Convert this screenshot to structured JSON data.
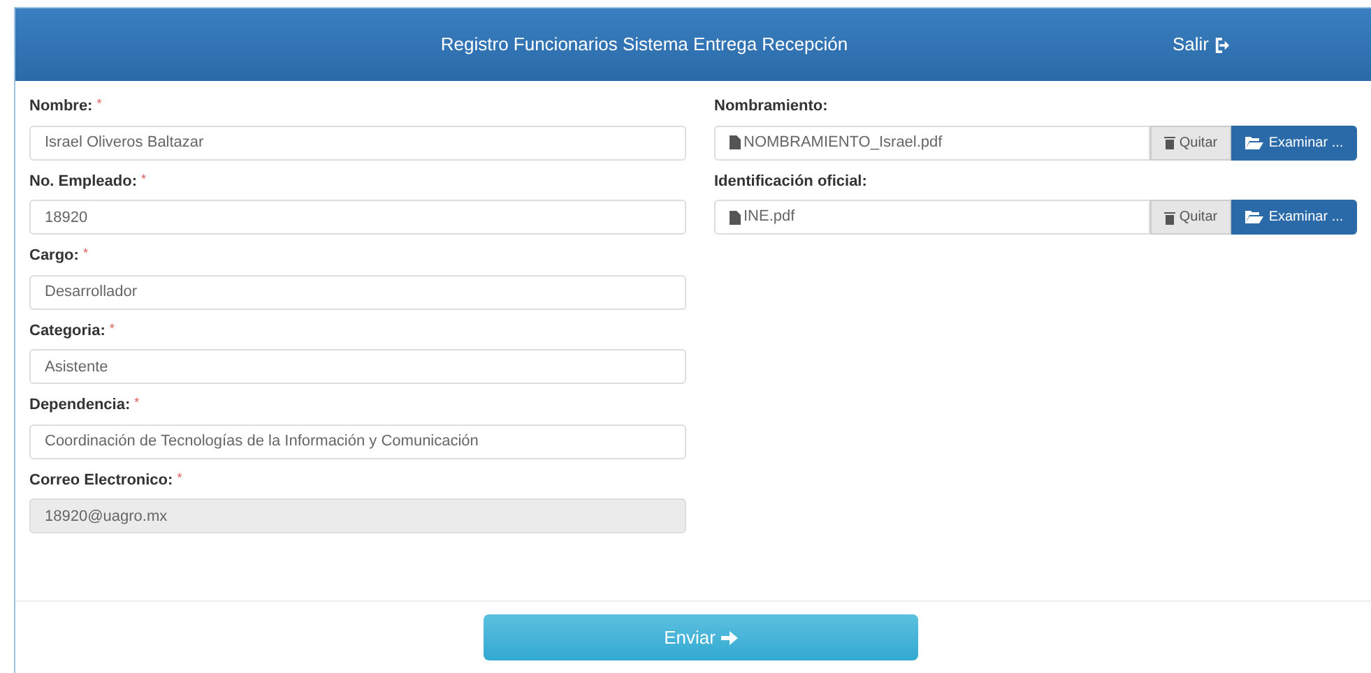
{
  "header": {
    "title": "Registro Funcionarios Sistema Entrega Recepción",
    "logout": "Salir"
  },
  "fields": [
    {
      "label": "Nombre:",
      "required": true,
      "value": "Israel Oliveros Baltazar",
      "disabled": false
    },
    {
      "label": "No. Empleado:",
      "required": true,
      "value": "18920",
      "disabled": false
    },
    {
      "label": "Cargo:",
      "required": true,
      "value": "Desarrollador",
      "disabled": false
    },
    {
      "label": "Categoria:",
      "required": true,
      "value": "Asistente",
      "disabled": false
    },
    {
      "label": "Dependencia:",
      "required": true,
      "value": "Coordinación de Tecnologías de la Información y Comunicación",
      "disabled": false
    },
    {
      "label": "Correo Electronico:",
      "required": true,
      "value": "18920@uagro.mx",
      "disabled": true
    }
  ],
  "required_mark": "*",
  "files": [
    {
      "label": "Nombramiento:",
      "filename": "NOMBRAMIENTO_Israel.pdf",
      "remove": "Quitar",
      "browse": "Examinar ..."
    },
    {
      "label": "Identificación oficial:",
      "filename": "INE.pdf",
      "remove": "Quitar",
      "browse": "Examinar ..."
    }
  ],
  "submit": "Enviar"
}
